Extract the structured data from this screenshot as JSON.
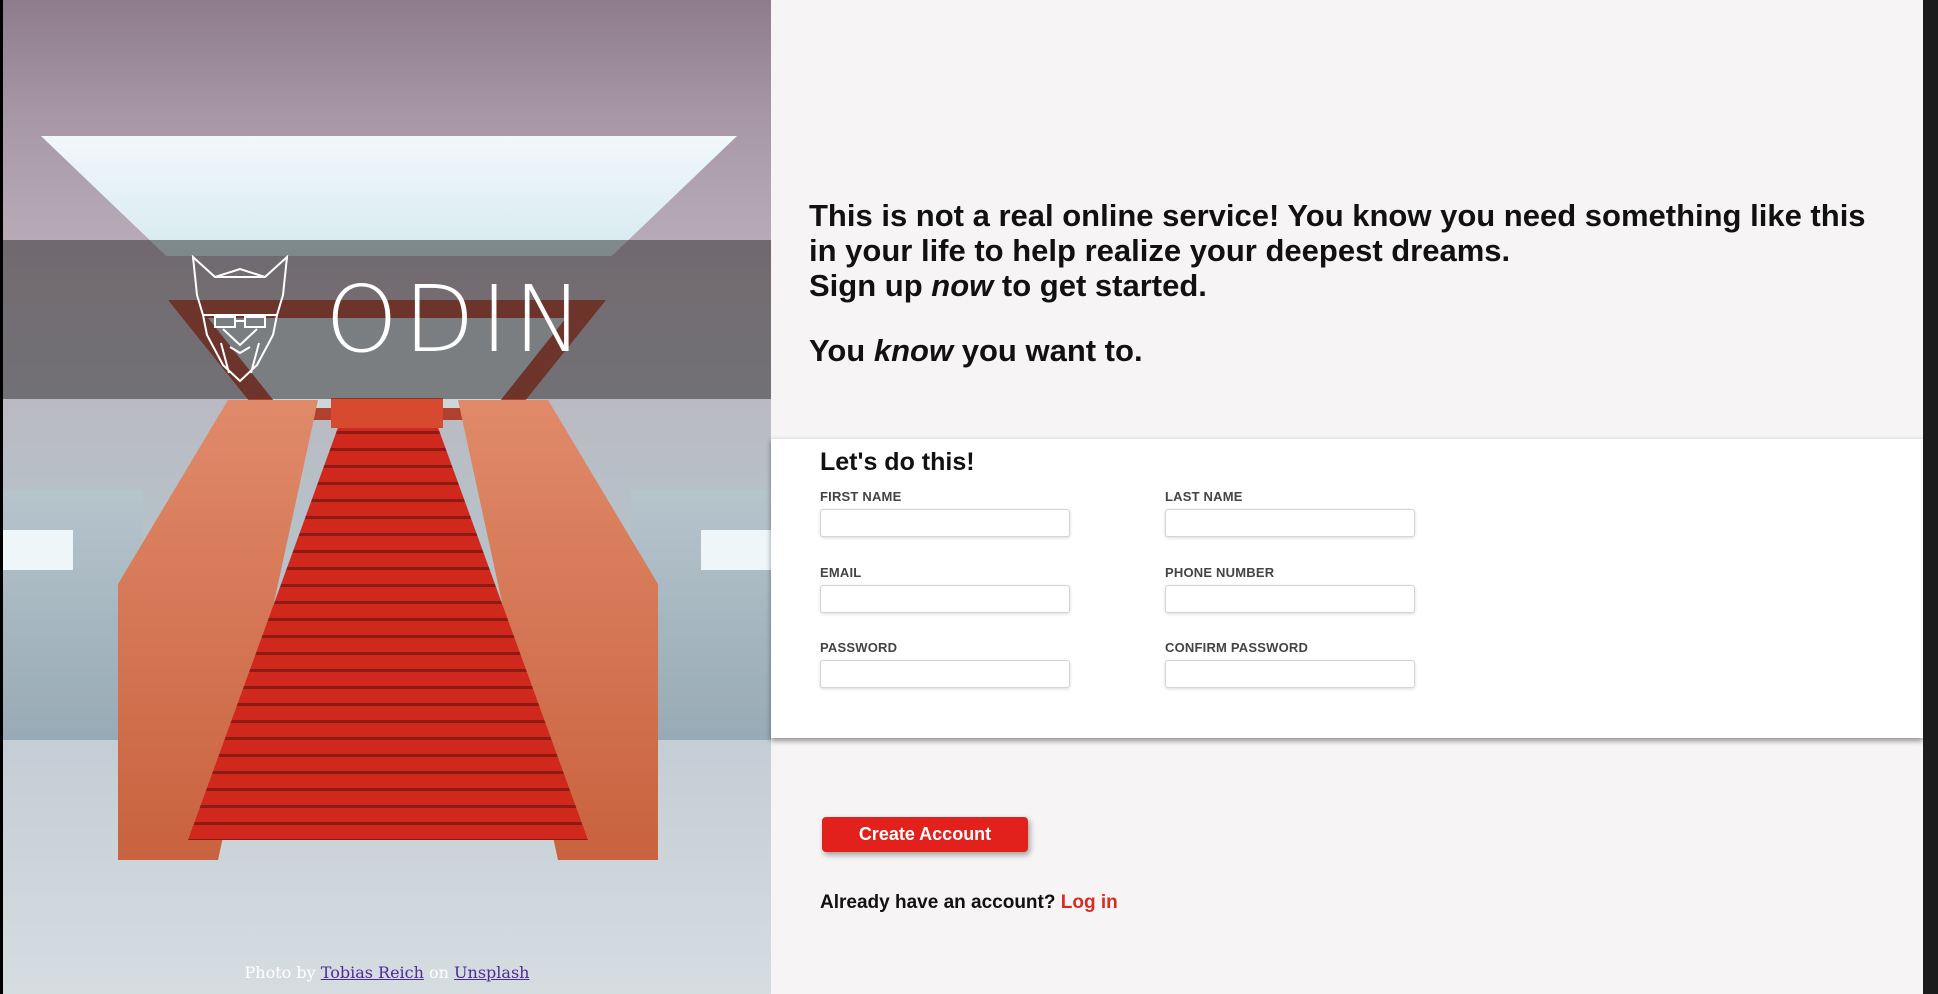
{
  "brand": {
    "wordmark": "ODIN",
    "logo_icon": "viking-helmet-icon"
  },
  "photo_credit": {
    "prefix": "Photo by",
    "author": "Tobias Reich",
    "middle": "on",
    "source": "Unsplash"
  },
  "intro": {
    "line1": "This is not a real online service! You know you need something like this in your life to help realize your deepest dreams.",
    "line2_pre": "Sign up",
    "line2_em": "now",
    "line2_post": "to get started.",
    "line3_pre": "You",
    "line3_em": "know",
    "line3_post": "you want to."
  },
  "form": {
    "title": "Let's do this!",
    "fields": [
      {
        "label": "FIRST NAME",
        "value": ""
      },
      {
        "label": "LAST NAME",
        "value": ""
      },
      {
        "label": "EMAIL",
        "value": ""
      },
      {
        "label": "PHONE NUMBER",
        "value": ""
      },
      {
        "label": "PASSWORD",
        "value": ""
      },
      {
        "label": "CONFIRM PASSWORD",
        "value": ""
      }
    ]
  },
  "actions": {
    "create_label": "Create Account",
    "login_prompt": "Already have an account?",
    "login_link": "Log in"
  },
  "colors": {
    "accent": "#e2211c",
    "link": "#d92c21",
    "panel_bg": "#f6f4f5"
  }
}
